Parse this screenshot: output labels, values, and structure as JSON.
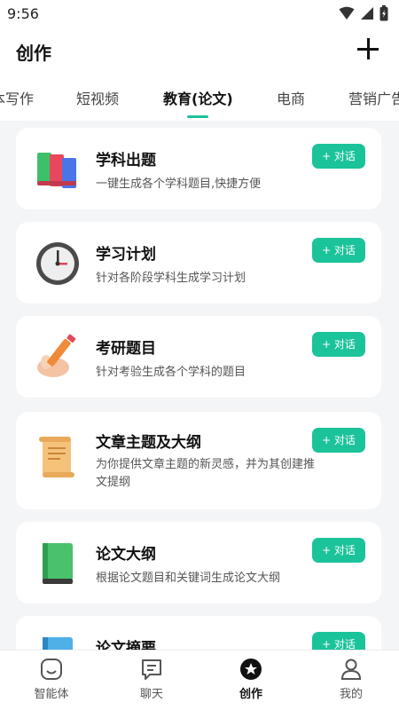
{
  "status_bar": {
    "time": "9:56"
  },
  "header": {
    "title": "创作"
  },
  "tabs": [
    {
      "label": "本写作"
    },
    {
      "label": "短视频"
    },
    {
      "label": "教育(论文)"
    },
    {
      "label": "电商"
    },
    {
      "label": "营销广告"
    }
  ],
  "active_tab": "教育(论文)",
  "colors": {
    "accent": "#1bc39a",
    "background": "#f4f5f7"
  },
  "cards": [
    {
      "title": "学科出题",
      "desc": "一键生成各个学科题目,快捷方便",
      "icon": "books-icon",
      "button": "+ 对话"
    },
    {
      "title": "学习计划",
      "desc": "针对各阶段学科生成学习计划",
      "icon": "clock-icon",
      "button": "+ 对话"
    },
    {
      "title": "考研题目",
      "desc": "针对考验生成各个学科的题目",
      "icon": "pencil-hand-icon",
      "button": "+ 对话"
    },
    {
      "title": "文章主题及大纲",
      "desc": "为你提供文章主题的新灵感，并为其创建推文提纲",
      "icon": "scroll-icon",
      "button": "+ 对话"
    },
    {
      "title": "论文大纲",
      "desc": "根据论文题目和关键词生成论文大纲",
      "icon": "green-book-icon",
      "button": "+ 对话"
    },
    {
      "title": "论文摘要",
      "desc": "",
      "icon": "blue-book-icon",
      "button": "+ 对话"
    }
  ],
  "bottom_nav": [
    {
      "label": "智能体",
      "icon": "agent-icon"
    },
    {
      "label": "聊天",
      "icon": "chat-icon"
    },
    {
      "label": "创作",
      "icon": "create-icon"
    },
    {
      "label": "我的",
      "icon": "profile-icon"
    }
  ],
  "active_nav": "创作"
}
